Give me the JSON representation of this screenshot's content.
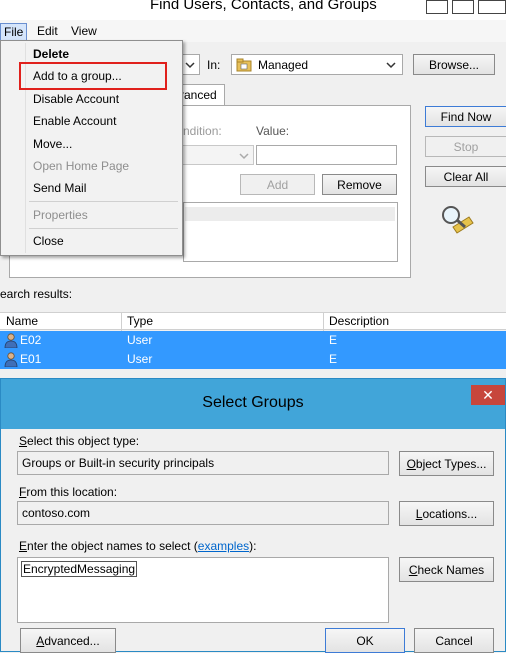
{
  "find_window": {
    "title": "Find Users, Contacts, and Groups",
    "menu": [
      "File",
      "Edit",
      "View"
    ],
    "file_menu": {
      "items": [
        {
          "label": "Delete",
          "bold": true,
          "enabled": true
        },
        {
          "label": "Add to a group...",
          "enabled": true,
          "highlighted": true
        },
        {
          "label": "Disable Account",
          "enabled": true
        },
        {
          "label": "Enable Account",
          "enabled": true
        },
        {
          "label": "Move...",
          "enabled": true
        },
        {
          "label": "Open Home Page",
          "enabled": false
        },
        {
          "label": "Send Mail",
          "enabled": true
        },
        {
          "label": "Properties",
          "enabled": false
        },
        {
          "label": "Close",
          "enabled": true
        }
      ]
    },
    "in_label": "In:",
    "in_value": "Managed",
    "browse_label": "Browse...",
    "tab_label": "ranced",
    "condition_label": "ndition:",
    "value_label": "Value:",
    "add_label": "Add",
    "remove_label": "Remove",
    "find_now_label": "Find Now",
    "stop_label": "Stop",
    "clear_all_label": "Clear All",
    "search_results_label": "earch results:",
    "results": {
      "columns": [
        "Name",
        "Type",
        "Description"
      ],
      "rows": [
        {
          "name": "E02",
          "type": "User",
          "description": "E"
        },
        {
          "name": "E01",
          "type": "User",
          "description": "E"
        }
      ]
    }
  },
  "select_groups": {
    "title": "Select Groups",
    "object_type_label": "Select this object type:",
    "object_type_value": "Groups or Built-in security principals",
    "object_types_button": "Object Types...",
    "location_label": "From this location:",
    "location_value": "contoso.com",
    "locations_button": "Locations...",
    "names_label": "Enter the object names to select (",
    "names_label_link": "examples",
    "names_label_end": "):",
    "names_value": "EncryptedMessaging",
    "check_names_button": "Check Names",
    "advanced_button": "Advanced...",
    "ok_button": "OK",
    "cancel_button": "Cancel"
  }
}
